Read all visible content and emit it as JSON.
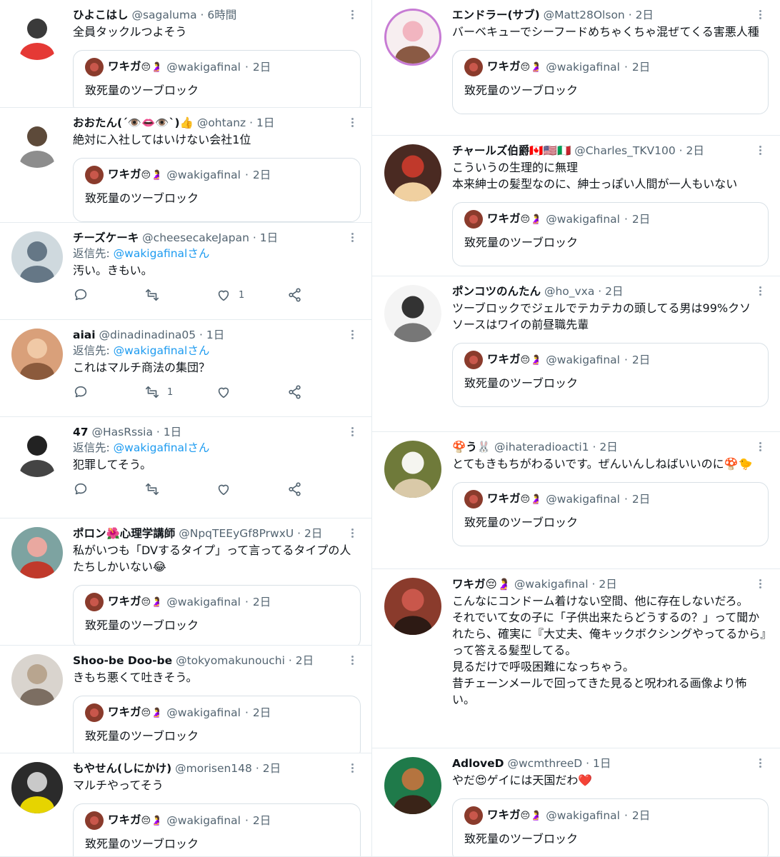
{
  "quoted_tweet": {
    "name": "ワキガ",
    "emoji": "😔🤰",
    "handle": "@wakigafinal",
    "time": "2日",
    "text": "致死量のツーブロック"
  },
  "reply_prefix": "返信先: ",
  "reply_target": "@wakigafinalさん",
  "separator": "·",
  "colors": {
    "link": "#1d9bf0",
    "muted": "#536471",
    "border": "#e6ecf0"
  },
  "left_column": [
    {
      "name": "ひよこはし",
      "handle": "@sagaluma",
      "time": "6時間",
      "text": "全員タックルつよそう",
      "has_quote": true,
      "avatar": "hiyoko-avatar"
    },
    {
      "name": "おおたん(´👁️👄👁️`)👍",
      "handle": "@ohtanz",
      "time": "1日",
      "text": "絶対に入社してはいけない会社1位",
      "has_quote": true,
      "avatar": "ohtan-avatar"
    },
    {
      "name": "チーズケーキ",
      "handle": "@cheesecakeJapan",
      "time": "1日",
      "text": "汚い。きもい。",
      "has_reply": true,
      "actions": {
        "reply": "",
        "retweet": "",
        "like": "1",
        "share": ""
      },
      "avatar": "default-avatar"
    },
    {
      "name": "aiai",
      "handle": "@dinadinadina05",
      "time": "1日",
      "text": "これはマルチ商法の集団？",
      "has_reply": true,
      "actions": {
        "reply": "",
        "retweet": "1",
        "like": "",
        "share": ""
      },
      "avatar": "aiai-avatar"
    },
    {
      "name": "47",
      "handle": "@HasRssia",
      "time": "1日",
      "text": "犯罪してそう。",
      "has_reply": true,
      "actions": {
        "reply": "",
        "retweet": "",
        "like": "",
        "share": ""
      },
      "avatar": "47-avatar"
    },
    {
      "name": "ポロン🌺心理学講師",
      "handle": "@NpqTEEyGf8PrwxU",
      "time": "2日",
      "text": "私がいつも「DVするタイプ」って言ってるタイプの人たちしかいない😂",
      "has_quote": true,
      "avatar": "poron-avatar"
    },
    {
      "name": "Shoo-be Doo-be",
      "handle": "@tokyomakunouchi",
      "time": "2日",
      "text": "きもち悪くて吐きそう。",
      "has_quote": true,
      "avatar": "shoobe-avatar"
    },
    {
      "name": "もやせん(しにかけ)",
      "handle": "@morisen148",
      "time": "2日",
      "text": "マルチやってそう",
      "has_quote": true,
      "avatar": "moyasen-avatar"
    }
  ],
  "right_column": [
    {
      "name": "エンドラー(サブ)",
      "handle": "@Matt28Olson",
      "time": "2日",
      "text": "バーベキューでシーフードめちゃくちゃ混ぜてくる害悪人種",
      "has_quote": true,
      "avatar": "endler-avatar"
    },
    {
      "name": "チャールズ伯爵🇨🇦🇺🇸🇮🇹",
      "handle": "@Charles_TKV100",
      "time": "2日",
      "text": "こういうの生理的に無理\n本来紳士の髪型なのに、紳士っぽい人間が一人もいない",
      "has_quote": true,
      "avatar": "charles-avatar"
    },
    {
      "name": "ポンコツのんたん",
      "handle": "@ho_vxa",
      "time": "2日",
      "text": "ツーブロックでジェルでテカテカの頭してる男は99%クソ\nソースはワイの前昼職先輩",
      "has_quote": true,
      "avatar": "ponkotsu-avatar"
    },
    {
      "name": "🍄う🐰",
      "handle": "@ihateradioacti1",
      "time": "2日",
      "text": "とてもきもちがわるいです。ぜんいんしねばいいのに🍄🐤",
      "has_quote": true,
      "avatar": "rabbit-avatar"
    },
    {
      "name": "ワキガ😔🤰",
      "handle": "@wakigafinal",
      "time": "2日",
      "text": "こんなにコンドーム着けない空間、他に存在しないだろ。\nそれでいて女の子に「子供出来たらどうするの？」って聞かれたら、確実に『大丈夫、俺キックボクシングやってるから』って答える髪型してる。\n見るだけで呼吸困難になっちゃう。\n昔チェーンメールで回ってきた見ると呪われる画像より怖い。",
      "has_quote": false,
      "avatar": "wakiga-avatar"
    },
    {
      "name": "AdloveD",
      "handle": "@wcmthreeD",
      "time": "1日",
      "text": "やだ😍ゲイには天国だわ❤️",
      "has_quote": true,
      "avatar": "adlove-avatar"
    }
  ]
}
